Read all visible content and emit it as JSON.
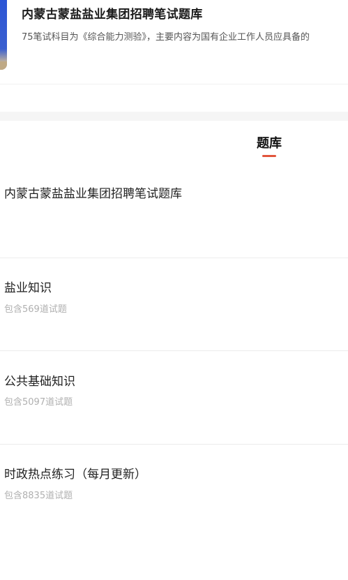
{
  "header": {
    "title": "内蒙古蒙盐盐业集团招聘笔试题库",
    "description": "75笔试科目为《综合能力测验》，主要内容为国有企业工作人员应具备的"
  },
  "tabs": [
    {
      "label": "题库",
      "active": true
    }
  ],
  "bank_title": "内蒙古蒙盐盐业集团招聘笔试题库",
  "items": [
    {
      "title": "盐业知识",
      "count": "包含569道试题"
    },
    {
      "title": "公共基础知识",
      "count": "包含5097道试题"
    },
    {
      "title": "时政热点练习（每月更新）",
      "count": "包含8835道试题"
    }
  ],
  "colors": {
    "accent": "#e2553c",
    "cover": "#2b55d6"
  }
}
